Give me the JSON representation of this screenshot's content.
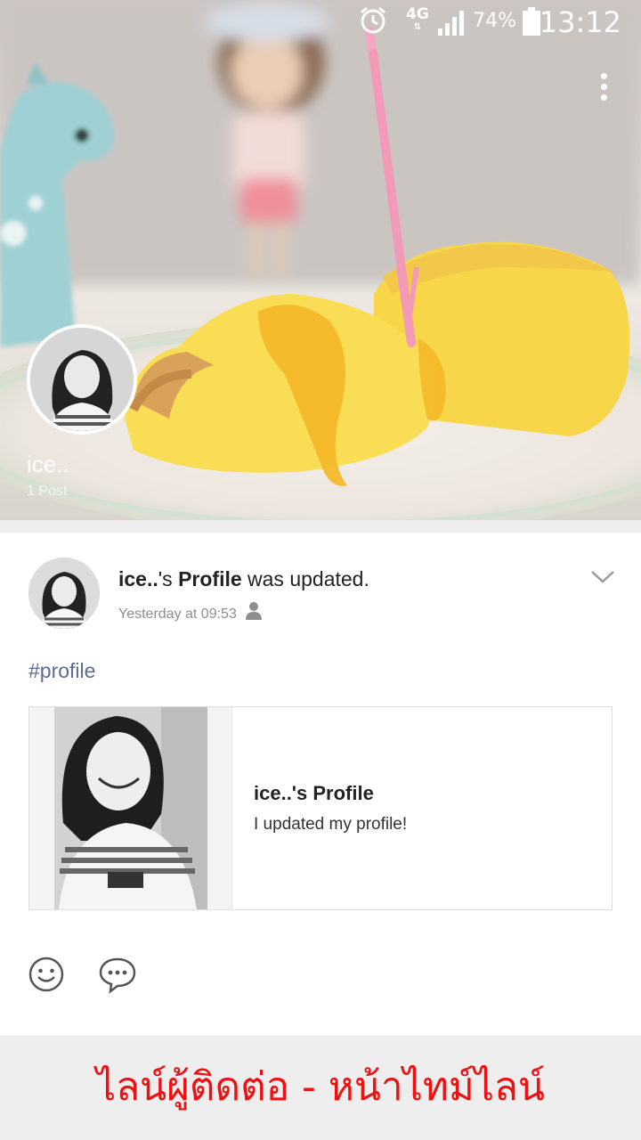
{
  "status_bar": {
    "network": "4G",
    "battery": "74%",
    "time": "13:12"
  },
  "cover": {
    "name": "ice..",
    "posts": "1 Post"
  },
  "post": {
    "author": "ice..",
    "possessive": "'s",
    "subject": "Profile",
    "action": " was updated.",
    "timestamp": "Yesterday at 09:53",
    "hashtag": "#profile",
    "card": {
      "title": "ice..'s Profile",
      "description": "I updated my profile!"
    }
  },
  "caption": "ไลน์ผู้ติดต่อ - หน้าไทม์ไลน์",
  "colors": {
    "hashtag": "#5b6b94",
    "caption": "#ee1111",
    "cake": "#f6d23a"
  }
}
